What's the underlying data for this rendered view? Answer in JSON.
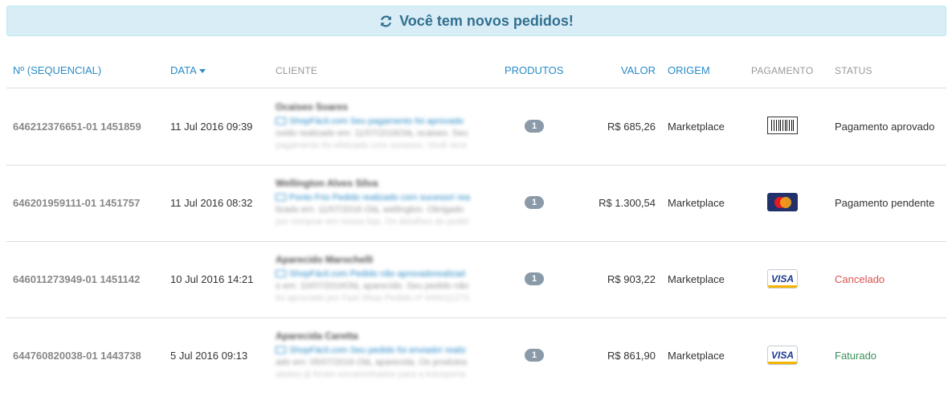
{
  "banner": {
    "text": "Você tem novos pedidos!",
    "icon": "refresh-icon"
  },
  "columns": {
    "sequencial": "Nº (SEQUENCIAL)",
    "data": "DATA",
    "cliente": "CLIENTE",
    "produtos": "PRODUTOS",
    "valor": "VALOR",
    "origem": "ORIGEM",
    "pagamento": "PAGAMENTO",
    "status": "STATUS"
  },
  "orders": [
    {
      "id": "646212376651-01 1451859",
      "date": "11 Jul 2016 09:39",
      "client_name": "Ocaiseo Soares",
      "client_msg": "ShopFácil.com Seu pagamento foi aprovado",
      "client_rest": "ovido realizado em: 11/07/2016Olá, ocaiseo. Seu",
      "client_rest2": "pagamento foi efetuado com sucesso. Você rece",
      "products": "1",
      "value": "R$ 685,26",
      "origin": "Marketplace",
      "payment": "boleto",
      "status": "Pagamento aprovado",
      "status_color": "#333333"
    },
    {
      "id": "646201959111-01 1451757",
      "date": "11 Jul 2016 08:32",
      "client_name": "Wellington Alves Silva",
      "client_msg": "Ponto Frio Pedido realizado com sucesso! rea",
      "client_rest": "lizado em: 11/07/2016 Olá, wellington. Obrigado",
      "client_rest2": "por comprar em nossa loja. Os detalhes do pedid",
      "products": "1",
      "value": "R$ 1.300,54",
      "origin": "Marketplace",
      "payment": "mastercard",
      "status": "Pagamento pendente",
      "status_color": "#333333"
    },
    {
      "id": "646011273949-01 1451142",
      "date": "10 Jul 2016 14:21",
      "client_name": "Aparecido Marochelli",
      "client_msg": "ShopFácil.com Pedido não aprovadorealizad",
      "client_rest": "o em: 10/07/2016Olá, aparecido. Seu pedido não",
      "client_rest2": "foi aprovado por Fast Shop Pedido nº 646011273",
      "products": "1",
      "value": "R$ 903,22",
      "origin": "Marketplace",
      "payment": "visa",
      "status": "Cancelado",
      "status_color": "#d9534f"
    },
    {
      "id": "644760820038-01 1443738",
      "date": "5 Jul 2016 09:13",
      "client_name": "Aparecida Caretta",
      "client_msg": "ShopFácil.com Seu pedido foi enviado! realiz",
      "client_rest": "ado em: 05/07/2016 Olá, aparecida. Os produtos",
      "client_rest2": "abaixo já foram encaminhados para a transporta",
      "products": "1",
      "value": "R$ 861,90",
      "origin": "Marketplace",
      "payment": "visa",
      "status": "Faturado",
      "status_color": "#3c8f5a"
    }
  ],
  "payment_labels": {
    "visa": "VISA",
    "mastercard": "MasterCard"
  }
}
